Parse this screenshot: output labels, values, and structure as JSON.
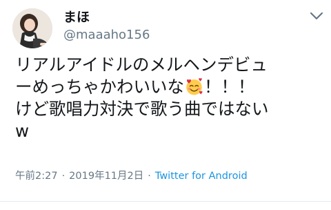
{
  "user": {
    "display_name": "まほ",
    "handle": "@maaaho156"
  },
  "tweet": {
    "line1": "リアルアイドルのメルヘンデビュ",
    "line2_before_emoji": "ーめっちゃかわいいな",
    "line2_after_emoji": "！！！",
    "line3": "けど歌唱力対決で歌う曲ではない",
    "line4": "w",
    "emoji": "smiling-face-with-hearts-icon"
  },
  "meta": {
    "time": "午前2:27",
    "separator": "·",
    "date": "2019年11月2日",
    "source": "Twitter for Android"
  },
  "colors": {
    "text": "#14171a",
    "secondary": "#657786",
    "link": "#1b95e0"
  }
}
